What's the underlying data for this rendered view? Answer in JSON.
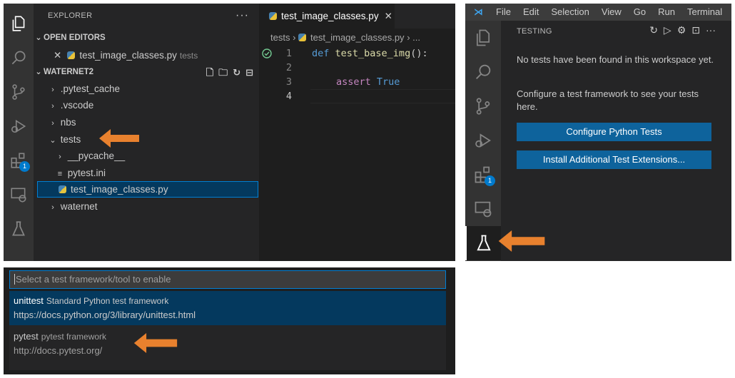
{
  "colors": {
    "accent_blue": "#007acc",
    "button_blue": "#0e639c",
    "arrow_orange": "#e8812e",
    "pass_green": "#73c991"
  },
  "explorer": {
    "title": "EXPLORER",
    "more": "···",
    "open_editors_label": "OPEN EDITORS",
    "open_editor_close": "✕",
    "open_editor_file": "test_image_classes.py",
    "open_editor_dir": "tests",
    "workspace_label": "WATERNET2",
    "tree": [
      {
        "label": ".pytest_cache",
        "chevron": "›"
      },
      {
        "label": ".vscode",
        "chevron": "›"
      },
      {
        "label": "nbs",
        "chevron": "›"
      },
      {
        "label": "tests",
        "chevron": "⌄"
      },
      {
        "label": "__pycache__",
        "chevron": "›"
      },
      {
        "label": "pytest.ini",
        "chevron": "≡"
      },
      {
        "label": "test_image_classes.py",
        "chevron": ""
      },
      {
        "label": "waternet",
        "chevron": "›"
      }
    ],
    "extensions_badge": "1"
  },
  "editor": {
    "tab_label": "test_image_classes.py",
    "tab_close": "✕",
    "breadcrumb_folder": "tests",
    "breadcrumb_file": "test_image_classes.py",
    "breadcrumb_more": "...",
    "lines": [
      {
        "num": "1",
        "kw": "def",
        "fn": "test_base_img",
        "rest": "():"
      },
      {
        "num": "2",
        "text": ""
      },
      {
        "num": "3",
        "kw2": "assert",
        "val": "True"
      },
      {
        "num": "4",
        "text": ""
      }
    ]
  },
  "menubar": {
    "items": [
      "File",
      "Edit",
      "Selection",
      "View",
      "Go",
      "Run",
      "Terminal"
    ]
  },
  "testing": {
    "title": "TESTING",
    "actions": [
      "↻",
      "▷",
      "⚙",
      "⊡",
      "···"
    ],
    "no_tests_message": "No tests have been found in this workspace yet.",
    "configure_message": "Configure a test framework to see your tests here.",
    "configure_button": "Configure Python Tests",
    "install_button": "Install Additional Test Extensions...",
    "extensions_badge": "1"
  },
  "quick_pick": {
    "placeholder": "Select a test framework/tool to enable",
    "items": [
      {
        "label": "unittest",
        "description": "Standard Python test framework",
        "detail": "https://docs.python.org/3/library/unittest.html"
      },
      {
        "label": "pytest",
        "description": "pytest framework",
        "detail": "http://docs.pytest.org/"
      }
    ]
  }
}
